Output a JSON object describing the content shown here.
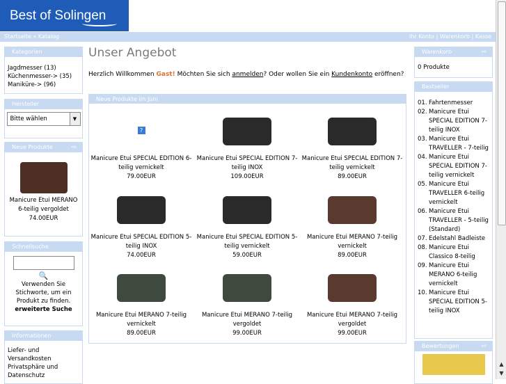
{
  "header": {
    "logo_text": "Best of Solingen"
  },
  "nav": {
    "breadcrumb": "Startseite » Katalog",
    "links": [
      "Ihr Konto",
      "|",
      "Warenkorb",
      "|",
      "Kasse"
    ]
  },
  "left": {
    "categories": {
      "title": "Kategorien",
      "items": [
        "Jagdmesser (13)",
        "Küchenmesser-> (35)",
        "Maniküre-> (96)"
      ]
    },
    "manufacturer": {
      "title": "Hersteller",
      "select": "Bitte wählen"
    },
    "new_products": {
      "title": "Neue Produkte",
      "name": "Manicure Etui MERANO 6-teilig vergoldet",
      "price": "74.00EUR"
    },
    "quicksearch": {
      "title": "Schnellsuche",
      "hint": "Verwenden Sie Stichworte, um ein Produkt zu finden.",
      "advanced": "erweiterte Suche"
    },
    "information": {
      "title": "Informationen",
      "items": [
        "Liefer- und Versandkosten",
        "Privatsphäre und Datenschutz"
      ]
    }
  },
  "main": {
    "title": "Unser Angebot",
    "welcome_1": "Herzlich Willkommen ",
    "welcome_guest": "Gast!",
    "welcome_2": " Möchten Sie sich ",
    "welcome_login": "anmelden",
    "welcome_3": "? Oder wollen Sie ein ",
    "welcome_account": "Kundenkonto",
    "welcome_4": " eröffnen?",
    "products_title": "Neue Produkte im Juni",
    "products": [
      {
        "name": "Manicure Etui SPECIAL EDITION 6-teilig vernickelt",
        "price": "79.00EUR",
        "img": "missing"
      },
      {
        "name": "Manicure Etui SPECIAL EDITION 7-teilig INOX",
        "price": "109.00EUR",
        "img": "dark"
      },
      {
        "name": "Manicure Etui SPECIAL EDITION 7-teilig vernickelt",
        "price": "89.00EUR",
        "img": "dark"
      },
      {
        "name": "Manicure Etui SPECIAL EDITION 5-teilig INOX",
        "price": "74.00EUR",
        "img": "dark"
      },
      {
        "name": "Manicure Etui SPECIAL EDITION 5-teilig vernickelt",
        "price": "59.00EUR",
        "img": "dark"
      },
      {
        "name": "Manicure Etui MERANO 7-teilig vernickelt",
        "price": "89.00EUR",
        "img": "brown"
      },
      {
        "name": "Manicure Etui MERANO 7-teilig vernickelt",
        "price": "89.00EUR",
        "img": "green"
      },
      {
        "name": "Manicure Etui MERANO 7-teilig vergoldet",
        "price": "99.00EUR",
        "img": "green"
      },
      {
        "name": "Manicure Etui MERANO 7-teilig vergoldet",
        "price": "99.00EUR",
        "img": "brown"
      }
    ]
  },
  "right": {
    "cart": {
      "title": "Warenkorb",
      "text": "0 Produkte"
    },
    "bestsellers": {
      "title": "Bestseller",
      "items": [
        {
          "num": "01.",
          "text": "Fahrtenmesser"
        },
        {
          "num": "02.",
          "text": "Manicure Etui SPECIAL EDITION 7-teilig INOX"
        },
        {
          "num": "03.",
          "text": "Manicure Etui TRAVELLER - 7-teilig"
        },
        {
          "num": "04.",
          "text": "Manicure Etui SPECIAL EDITION 7-teilig vernickelt"
        },
        {
          "num": "05.",
          "text": "Manicure Etui TRAVELLER 6-teilig vernickelt"
        },
        {
          "num": "06.",
          "text": "Manicure Etui TRAVELLER - 5-teilig (Standard)"
        },
        {
          "num": "07.",
          "text": "Edelstahl Badleiste"
        },
        {
          "num": "08.",
          "text": "Manicure Etui Classico 8-teilig"
        },
        {
          "num": "09.",
          "text": "Manicure Etui MERANO 6-teilig vernickelt"
        },
        {
          "num": "10.",
          "text": "Manicure Etui SPECIAL EDITION 5-teilig INOX"
        }
      ]
    },
    "reviews": {
      "title": "Bewertungen"
    }
  },
  "colors": {
    "brand": "#1f5cb8",
    "box_header": "#c7daf2",
    "title": "#7a7a7a",
    "guest": "#e07030"
  }
}
